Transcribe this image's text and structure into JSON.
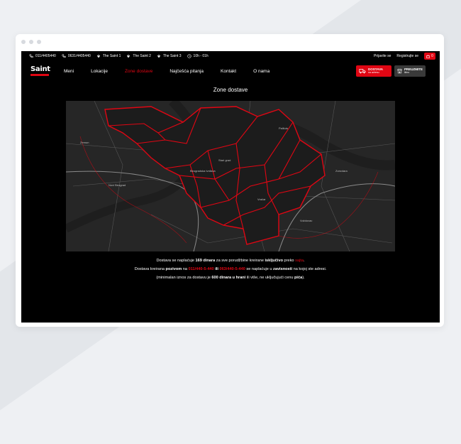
{
  "topbar": {
    "phone1": "011/4405440",
    "phone2": "0631/4405440",
    "loc1": "The Saint 1",
    "loc2": "The Saint 2",
    "loc3": "The Saint 3",
    "hours": "10h - 01h",
    "login": "Prijavite se",
    "register": "Registrujte se",
    "cart_count": "0"
  },
  "nav": {
    "logo_text": "Saint",
    "items": [
      "Meni",
      "Lokacije",
      "Zone dostave",
      "Najčešća pitanja",
      "Kontakt",
      "O nama"
    ],
    "active_item": "Zone dostave",
    "delivery_line1": "DOSTAVA",
    "delivery_line2": "na adresu",
    "pickup_line1": "PREUZMITE",
    "pickup_line2": "lično"
  },
  "page": {
    "title": "Zone dostave"
  },
  "map": {
    "labels": [
      "Beogradska tvrđava",
      "Stari grad",
      "Vračar",
      "Zvezdara",
      "Novi Beograd",
      "Zemun",
      "Voždovac",
      "Palilula"
    ]
  },
  "info": {
    "line1_a": "Dostava se naplaćuje ",
    "line1_price": "169 dinara",
    "line1_b": " za sve porudžbine kreirane ",
    "line1_excl": "isključivo",
    "line1_c": " preko ",
    "line1_site": "sajta",
    "line1_end": ".",
    "line2_a": "Dostava kreirana ",
    "line2_call": "pozivom",
    "line2_b": " na ",
    "line2_phone1": "011/440-5-440",
    "line2_or": " ili ",
    "line2_phone2": "063/440-5-440",
    "line2_c": " se naplaćuje u ",
    "line2_dep": "zavisnosti",
    "line2_d": " na kojoj ste adresi.",
    "line3_a": "(minimalan iznos za dostavu je ",
    "line3_min": "600 dinara u hrani",
    "line3_b": " ili više, ne uključujući cenu ",
    "line3_drinks": "pića",
    "line3_end": ")."
  },
  "colors": {
    "accent": "#e00613",
    "background": "#000000",
    "map": "#262626"
  }
}
